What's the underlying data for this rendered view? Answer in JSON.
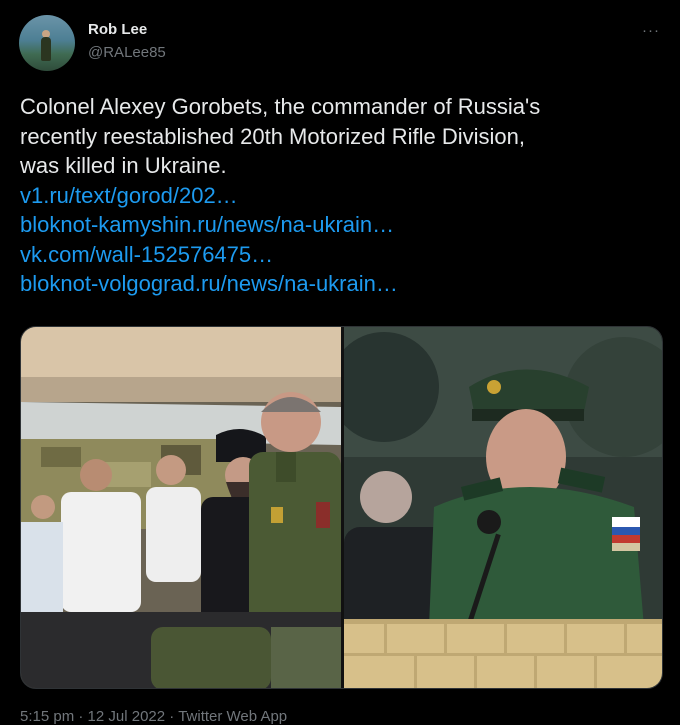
{
  "author": {
    "name": "Rob Lee",
    "handle": "@RALee85"
  },
  "menu": {
    "more_glyph": "···"
  },
  "tweet": {
    "text_lines": [
      "Colonel Alexey Gorobets, the commander of Russia's",
      "recently reestablished 20th Motorized Rifle Division,",
      "was killed in Ukraine."
    ],
    "links": [
      "v1.ru/text/gorod/202…",
      "bloknot-kamyshin.ru/news/na-ukrain…",
      "vk.com/wall-152576475…",
      "bloknot-volgograd.ru/news/na-ukrain…"
    ]
  },
  "meta": {
    "time": "5:15 pm",
    "sep1": " · ",
    "date": "12 Jul 2022",
    "sep2": " · ",
    "app": "Twitter Web App"
  },
  "colors": {
    "background": "#000000",
    "text": "#e7e9ea",
    "secondary": "#71767b",
    "link": "#1d9bf0"
  }
}
